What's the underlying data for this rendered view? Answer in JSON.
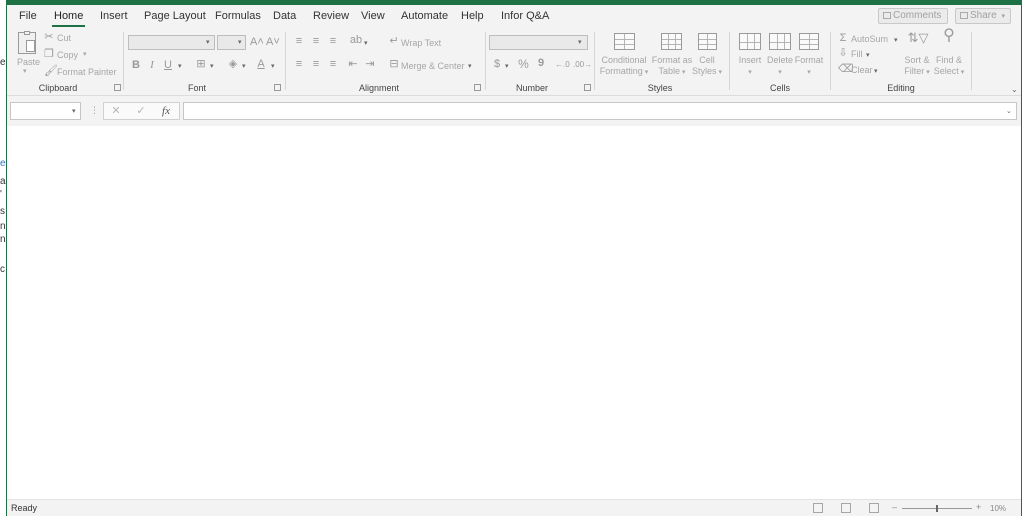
{
  "left_edge_chars": [
    "e",
    "e",
    "a",
    "'",
    "s",
    "n",
    "n",
    "c"
  ],
  "menu": {
    "items": [
      "File",
      "Home",
      "Insert",
      "Page Layout",
      "Formulas",
      "Data",
      "Review",
      "View",
      "Automate",
      "Help",
      "Infor Q&A"
    ],
    "active": "Home",
    "comments_label": "Comments",
    "share_label": "Share"
  },
  "ribbon": {
    "clipboard": {
      "label": "Clipboard",
      "paste": "Paste",
      "cut": "Cut",
      "copy": "Copy",
      "format_painter": "Format Painter"
    },
    "font": {
      "label": "Font",
      "bold": "B",
      "italic": "I",
      "underline": "U",
      "grow": "A˄",
      "shrink": "A˅",
      "font_color": "A"
    },
    "alignment": {
      "label": "Alignment",
      "wrap_text": "Wrap Text",
      "merge_center": "Merge & Center"
    },
    "number": {
      "label": "Number",
      "currency": "$",
      "percent": "%",
      "comma": "9",
      "inc_decimal": "←.0",
      "dec_decimal": ".00→"
    },
    "styles": {
      "label": "Styles",
      "conditional_1": "Conditional",
      "conditional_2": "Formatting",
      "format_table_1": "Format as",
      "format_table_2": "Table",
      "cell_styles_1": "Cell",
      "cell_styles_2": "Styles"
    },
    "cells": {
      "label": "Cells",
      "insert": "Insert",
      "delete": "Delete",
      "format": "Format"
    },
    "editing": {
      "label": "Editing",
      "autosum": "AutoSum",
      "fill": "Fill",
      "clear": "Clear",
      "sort_1": "Sort &",
      "sort_2": "Filter",
      "find_1": "Find &",
      "find_2": "Select"
    }
  },
  "formula_bar": {
    "cancel": "✕",
    "enter": "✓",
    "fx": "fx"
  },
  "status": {
    "text": "Ready",
    "zoom_minus": "–",
    "zoom_plus": "+",
    "zoom": "10%"
  }
}
